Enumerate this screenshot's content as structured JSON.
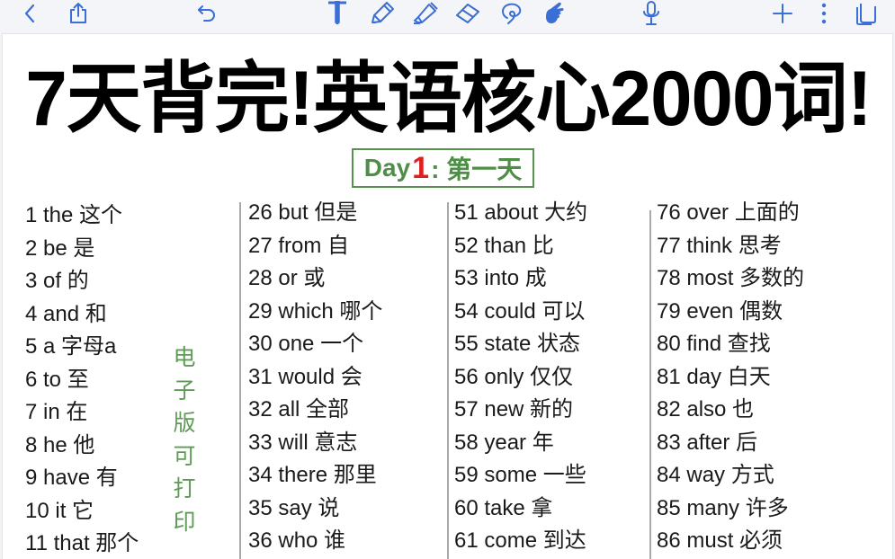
{
  "toolbar": {
    "left": [
      {
        "name": "back",
        "icon": "chevron-left-icon"
      },
      {
        "name": "share",
        "icon": "share-icon"
      },
      {
        "name": "undo",
        "icon": "undo-icon"
      }
    ],
    "tools": [
      {
        "name": "text-tool",
        "icon": "text-cursor-icon"
      },
      {
        "name": "pen-tool",
        "icon": "pen-icon"
      },
      {
        "name": "highlighter-tool",
        "icon": "highlighter-icon"
      },
      {
        "name": "eraser-tool",
        "icon": "eraser-icon"
      },
      {
        "name": "lasso-tool",
        "icon": "lasso-icon"
      },
      {
        "name": "hand-tool",
        "icon": "hand-pointer-icon",
        "active": true
      },
      {
        "name": "microphone",
        "icon": "microphone-icon"
      }
    ],
    "right": [
      {
        "name": "add-page",
        "icon": "plus-icon"
      },
      {
        "name": "more",
        "icon": "more-vertical-icon"
      },
      {
        "name": "pages",
        "icon": "pages-icon"
      }
    ],
    "accent_color": "#3b6fd6"
  },
  "document": {
    "title": "7天背完!英语核心2000词!",
    "day_label": {
      "prefix": "Day",
      "number": "1",
      "suffix": ": 第一天",
      "frame_color": "#58924f",
      "number_color": "#e02020"
    },
    "side_note": [
      "电",
      "子",
      "版",
      "可",
      "打",
      "印"
    ],
    "columns": [
      [
        "1 the 这个",
        "2 be 是",
        "3 of 的",
        "4 and 和",
        "5 a 字母a",
        "6 to 至",
        "7 in 在",
        "8 he 他",
        "9 have 有",
        "10 it 它",
        "11 that 那个"
      ],
      [
        "26 but 但是",
        "27 from 自",
        "28 or 或",
        "29 which 哪个",
        "30 one 一个",
        "31 would 会",
        "32 all 全部",
        "33 will 意志",
        "34 there 那里",
        "35 say 说",
        "36 who 谁"
      ],
      [
        "51 about 大约",
        "52 than 比",
        "53 into 成",
        "54 could 可以",
        "55 state 状态",
        "56 only 仅仅",
        "57 new 新的",
        "58 year 年",
        "59 some 一些",
        "60 take 拿",
        "61 come 到达"
      ],
      [
        "76 over 上面的",
        "77 think 思考",
        "78 most 多数的",
        "79 even 偶数",
        "80 find 查找",
        "81 day 白天",
        "82 also 也",
        "83 after 后",
        "84 way 方式",
        "85 many 许多",
        "86 must 必须"
      ]
    ]
  }
}
